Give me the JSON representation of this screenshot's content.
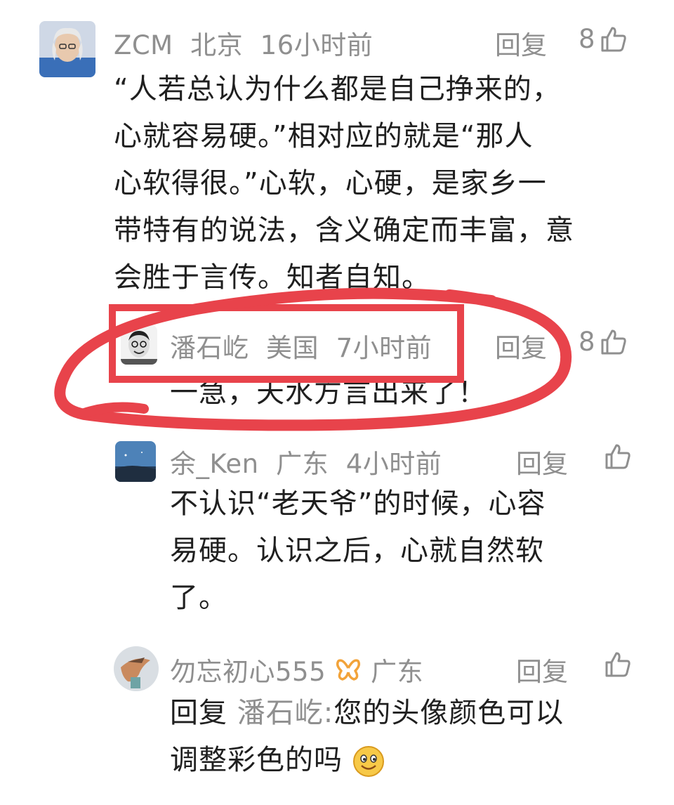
{
  "comments": [
    {
      "user": "ZCM",
      "location": "北京",
      "time": "16小时前",
      "reply_label": "回复",
      "likes": "8",
      "text_lines": [
        "“人若总认为什么都是自己挣来的，",
        "心就容易硬。”相对应的就是“那人",
        "心软得很。”心软，心硬，是家乡一",
        "带特有的说法，含义确定而丰富，意",
        "会胜于言传。知者自知。"
      ]
    },
    {
      "user": "潘石屹",
      "location": "美国",
      "time": "7小时前",
      "reply_label": "回复",
      "likes": "8",
      "text": "一急，天水方言出来了！"
    },
    {
      "user": "余_Ken",
      "location": "广东",
      "time": "4小时前",
      "reply_label": "回复",
      "text_lines": [
        "不认识“老天爷”的时候，心容",
        "易硬。认识之后，心就自然软",
        "了。"
      ]
    },
    {
      "user": "勿忘初心555",
      "location": "广东",
      "reply_label": "回复",
      "reply_prefix": "回复",
      "mention": "潘石屹:",
      "text_rest": "您的头像颜色可以",
      "text_line2": "调整彩色的吗"
    }
  ],
  "colors": {
    "highlight_circle": "#e8434b",
    "meta_gray": "#8f8f8f",
    "badge_orange": "#f2a33a"
  },
  "icons": {
    "like": "thumb-up-icon",
    "badge": "butterfly-badge-icon",
    "emoji": "smiley-emoji"
  }
}
